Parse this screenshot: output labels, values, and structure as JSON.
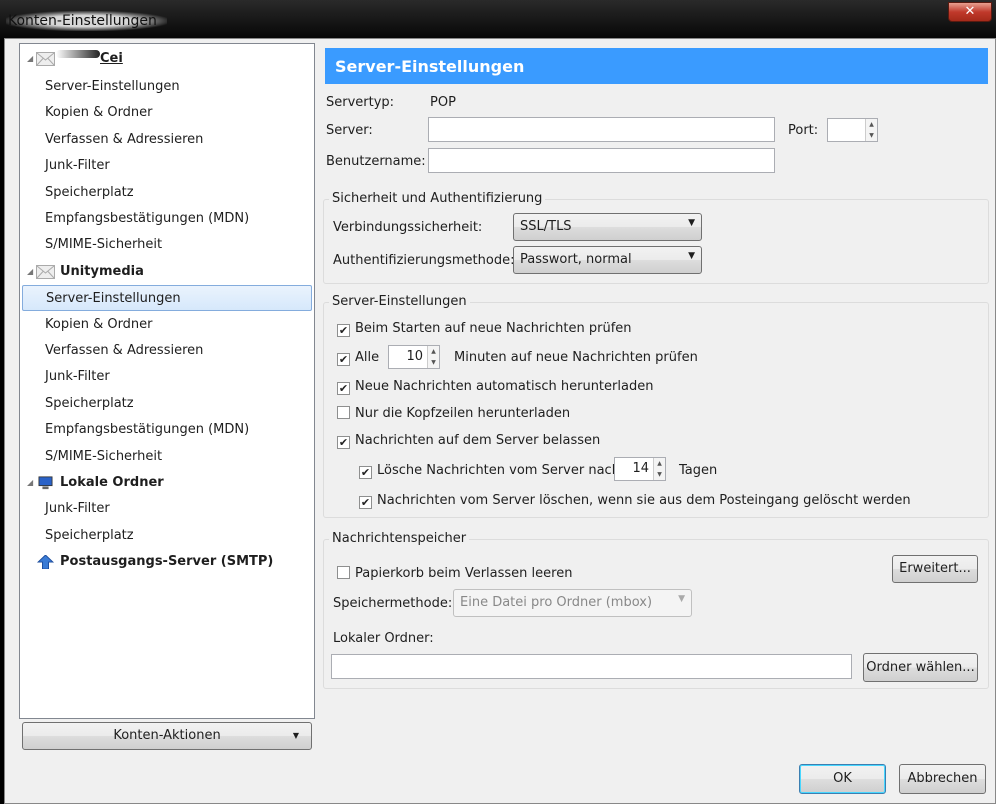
{
  "window": {
    "title": "Konten-Einstellungen",
    "close": "✕"
  },
  "tree": {
    "account1": {
      "name": "Cei",
      "items": [
        "Server-Einstellungen",
        "Kopien & Ordner",
        "Verfassen & Adressieren",
        "Junk-Filter",
        "Speicherplatz",
        "Empfangsbestätigungen (MDN)",
        "S/MIME-Sicherheit"
      ]
    },
    "account2": {
      "name": "Unitymedia",
      "items": [
        "Server-Einstellungen",
        "Kopien & Ordner",
        "Verfassen & Adressieren",
        "Junk-Filter",
        "Speicherplatz",
        "Empfangsbestätigungen (MDN)",
        "S/MIME-Sicherheit"
      ]
    },
    "local": {
      "name": "Lokale Ordner",
      "items": [
        "Junk-Filter",
        "Speicherplatz"
      ]
    },
    "smtp": {
      "name": "Postausgangs-Server (SMTP)"
    }
  },
  "account_actions": "Konten-Aktionen",
  "panel": {
    "title": "Server-Einstellungen",
    "servertype_label": "Servertyp:",
    "servertype_value": "POP",
    "server_label": "Server:",
    "server_value": "",
    "port_label": "Port:",
    "port_value": "",
    "username_label": "Benutzername:",
    "username_value": "",
    "security": {
      "legend": "Sicherheit und Authentifizierung",
      "conn_label": "Verbindungssicherheit:",
      "conn_value": "SSL/TLS",
      "auth_label": "Authentifizierungsmethode:",
      "auth_value": "Passwort, normal"
    },
    "server_settings": {
      "legend": "Server-Einstellungen",
      "check_start": "Beim Starten auf neue Nachrichten prüfen",
      "every": "Alle",
      "every_value": "10",
      "minutes": "Minuten auf neue Nachrichten prüfen",
      "auto_download": "Neue Nachrichten automatisch herunterladen",
      "headers_only": "Nur die Kopfzeilen herunterladen",
      "leave_on_server": "Nachrichten auf dem Server belassen",
      "delete_after": "Lösche Nachrichten vom Server nach",
      "delete_days": "14",
      "days": "Tagen",
      "delete_when_removed": "Nachrichten vom Server löschen, wenn sie aus dem Posteingang gelöscht werden"
    },
    "storage": {
      "legend": "Nachrichtenspeicher",
      "empty_trash": "Papierkorb beim Verlassen leeren",
      "advanced": "Erweitert...",
      "method_label": "Speichermethode:",
      "method_value": "Eine Datei pro Ordner (mbox)",
      "local_label": "Lokaler Ordner:",
      "local_value": "",
      "choose": "Ordner wählen..."
    }
  },
  "ok": "OK",
  "cancel": "Abbrechen"
}
